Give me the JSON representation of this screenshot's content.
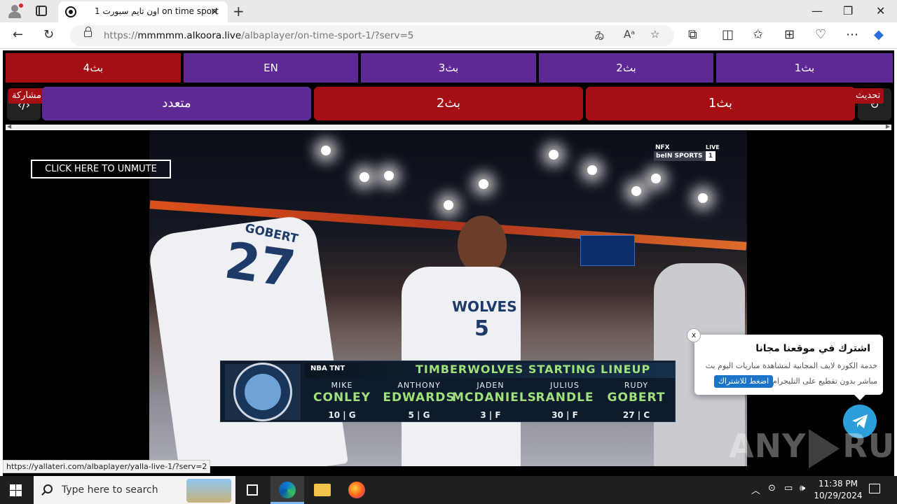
{
  "browser": {
    "tab_title": "اون تايم سبورت 1 on time sport",
    "tab_close": "✕",
    "new_tab": "+",
    "url_prefix": "https://",
    "url_host": "mmmmm.alkoora.live",
    "url_path": "/albaplayer/on-time-sport-1/?serv=5",
    "window_min": "—",
    "window_max": "❐",
    "window_close": "✕"
  },
  "servers_row": [
    "بث4",
    "EN",
    "بث3",
    "بث2",
    "بث1"
  ],
  "main_row": {
    "left_side_label": "مشاركة",
    "right_side_label": "تحديث",
    "left_btn": "متعدد",
    "middle_btn": "بث2",
    "right_btn": "بث1"
  },
  "video": {
    "unmute_label": "CLICK HERE TO UNMUTE",
    "channel": "beIN SPORTS",
    "channel_num": "1",
    "channel_tag": "NFX",
    "live_tag": "LIVE",
    "jersey_name": "GOBERT",
    "jersey_number_left": "27",
    "jersey_team": "WOLVES",
    "jersey_number_center": "5",
    "lineup_title": "TIMBERWOLVES STARTING LINEUP",
    "lineup_network": "NBA TNT",
    "lineup_logo_text": "MINNESOTA TIMBERWOLVES",
    "players": [
      {
        "first": "MIKE",
        "last": "CONLEY",
        "stat": "10 | G"
      },
      {
        "first": "ANTHONY",
        "last": "EDWARDS",
        "stat": "5 | G"
      },
      {
        "first": "JADEN",
        "last": "MCDANIELS",
        "stat": "3 | F"
      },
      {
        "first": "JULIUS",
        "last": "RANDLE",
        "stat": "30 | F"
      },
      {
        "first": "RUDY",
        "last": "GOBERT",
        "stat": "27 | C"
      }
    ]
  },
  "popup": {
    "close": "x",
    "title": "اشترك في موقعنا مجانا",
    "desc_line1": "خدمة الكورة لايف المجانية لمشاهدة مباريات اليوم بث",
    "desc_line2": "مباشر بدون تقطيع على التليجرام",
    "button": "اضغط للاشتراك"
  },
  "watermark": {
    "left": "ANY",
    "right": "RUN"
  },
  "status_url": "https://yallateri.com/albaplayer/yalla-live-1/?serv=2",
  "taskbar": {
    "search_placeholder": "Type here to search",
    "time": "11:38 PM",
    "date": "10/29/2024"
  },
  "colors": {
    "red": "#a50e12",
    "purple": "#5e2895",
    "telegram": "#2a9fd9"
  }
}
